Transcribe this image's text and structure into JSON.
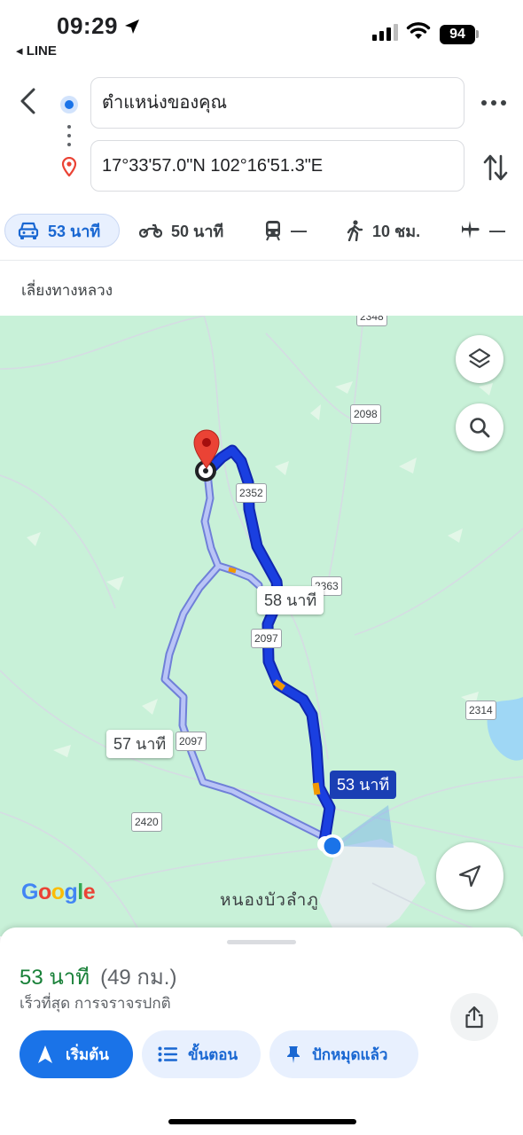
{
  "status_bar": {
    "time": "09:29",
    "back_app": "◂ LINE",
    "battery": "94"
  },
  "directions": {
    "origin": "ตำแหน่งของคุณ",
    "destination": "17°33'57.0\"N 102°16'51.3\"E"
  },
  "modes": [
    {
      "icon": "car-icon",
      "label": "53 นาที",
      "selected": true
    },
    {
      "icon": "motorcycle-icon",
      "label": "50 นาที"
    },
    {
      "icon": "transit-icon",
      "label": "—"
    },
    {
      "icon": "walk-icon",
      "label": "10 ชม."
    },
    {
      "icon": "flight-icon",
      "label": "—"
    }
  ],
  "route_option": "เลี่ยงทางหลวง",
  "map": {
    "road_shields": [
      "2348",
      "2098",
      "2352",
      "2363",
      "2097",
      "2314",
      "2097",
      "2420"
    ],
    "route_labels": {
      "selected": "53 นาที",
      "alt_1": "58 นาที",
      "alt_2": "57 นาที"
    },
    "town": "หนองบัวลำภู",
    "logo": "Google",
    "colors": {
      "land": "#c8f1d8",
      "route_selected": "#1a3fe0",
      "route_alt": "#9fb0f0",
      "pin": "#ea4335"
    }
  },
  "summary": {
    "duration": "53 นาที",
    "distance": "(49 กม.)",
    "subtitle": "เร็วที่สุด การจราจรปกติ"
  },
  "actions": {
    "start": "เริ่มต้น",
    "steps": "ขั้นตอน",
    "pinned": "ปักหมุดแล้ว"
  }
}
